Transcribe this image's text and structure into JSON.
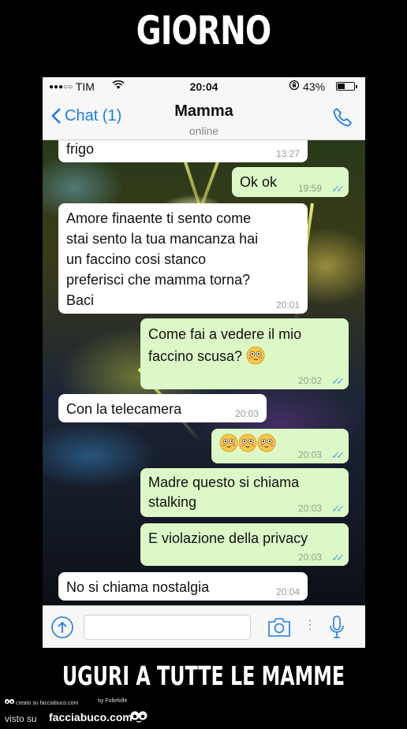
{
  "meme": {
    "top_caption": "GIORNO",
    "bottom_caption": "UGURI A TUTTE LE MAMME"
  },
  "status_bar": {
    "signal_dots": "●●●○○",
    "carrier": "TIM",
    "time": "20:04",
    "battery_percent": "43%",
    "battery_level": 0.43
  },
  "nav": {
    "back_label": "Chat (1)",
    "contact_name": "Mamma",
    "contact_status": "online"
  },
  "messages": [
    {
      "direction": "in",
      "text": "frigo",
      "time": "13:27"
    },
    {
      "direction": "out",
      "text": "Ok ok",
      "time": "19:59",
      "read": true
    },
    {
      "direction": "in",
      "lines": [
        "Amore finaente ti sento come",
        "stai sento la tua mancanza hai",
        "un faccino cosi stanco",
        "preferisci che mamma torna?",
        "Baci"
      ],
      "time": "20:01"
    },
    {
      "direction": "out",
      "lines": [
        "Come fai a vedere il mio",
        "faccino scusa?"
      ],
      "emoji": "flushed-face",
      "time": "20:02",
      "read": true
    },
    {
      "direction": "in",
      "text": "Con la telecamera",
      "time": "20:03"
    },
    {
      "direction": "out",
      "emoji": "flushed-face",
      "emoji_count": 3,
      "time": "20:03",
      "read": true
    },
    {
      "direction": "out",
      "lines": [
        "Madre questo si chiama",
        "stalking"
      ],
      "time": "20:03",
      "read": true
    },
    {
      "direction": "out",
      "text": "E violazione della privacy",
      "time": "20:03",
      "read": true
    },
    {
      "direction": "in",
      "text": "No si chiama nostalgia",
      "time": "20:04"
    }
  ],
  "input_bar": {
    "value": "",
    "icons": [
      "upload-icon",
      "camera-icon",
      "microphone-icon"
    ]
  },
  "footer": {
    "credit": "creato su facciabuco.com",
    "author": "by Follefolle",
    "visto": "visto su",
    "site": "facciabuco.com"
  },
  "colors": {
    "ios_blue": "#1e7ce8",
    "bubble_out": "#dcf8c6",
    "bubble_in": "#ffffff",
    "read_ticks": "#4fa4e8"
  }
}
